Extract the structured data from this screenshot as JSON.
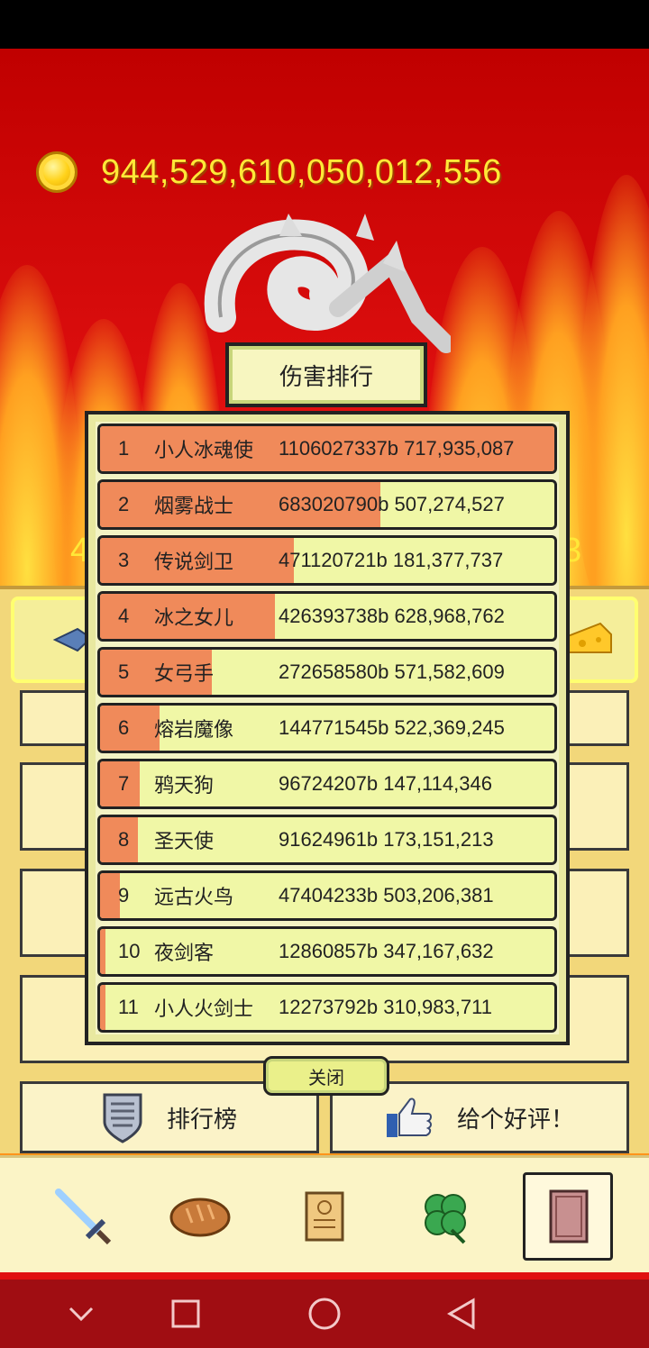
{
  "gold": {
    "amount": "944,529,610,050,012,556",
    "icon": "gold-coin-icon"
  },
  "colors": {
    "background_fire": "#e01010",
    "gold_text": "#ffe838",
    "rank_bar": "#f08a5a",
    "row_fill": "#f0f7a6"
  },
  "side_numbers": {
    "left": "4",
    "right": "3"
  },
  "ranking": {
    "title": "伤害排行",
    "rows": [
      {
        "rank": "1",
        "name": "小人冰魂使",
        "value": "1106027337b 717,935,087",
        "bar": 1.0
      },
      {
        "rank": "2",
        "name": "烟雾战士",
        "value": "683020790b 507,274,527",
        "bar": 0.617
      },
      {
        "rank": "3",
        "name": "传说剑卫",
        "value": "471120721b 181,377,737",
        "bar": 0.426
      },
      {
        "rank": "4",
        "name": "冰之女儿",
        "value": "426393738b 628,968,762",
        "bar": 0.385
      },
      {
        "rank": "5",
        "name": "女弓手",
        "value": "272658580b 571,582,609",
        "bar": 0.246
      },
      {
        "rank": "6",
        "name": "熔岩魔像",
        "value": "144771545b 522,369,245",
        "bar": 0.131
      },
      {
        "rank": "7",
        "name": "鸦天狗",
        "value": "96724207b 147,114,346",
        "bar": 0.087
      },
      {
        "rank": "8",
        "name": "圣天使",
        "value": "91624961b 173,151,213",
        "bar": 0.083
      },
      {
        "rank": "9",
        "name": "远古火鸟",
        "value": "47404233b 503,206,381",
        "bar": 0.043
      },
      {
        "rank": "10",
        "name": "夜剑客",
        "value": "12860857b 347,167,632",
        "bar": 0.012
      },
      {
        "rank": "11",
        "name": "小人火剑士",
        "value": "12273792b 310,983,711",
        "bar": 0.011
      }
    ],
    "close_label": "关闭"
  },
  "bottom_buttons": {
    "leaderboard": {
      "label": "排行榜",
      "icon": "shield-icon"
    },
    "review": {
      "label": "给个好评！",
      "icon": "thumbs-up-icon"
    }
  },
  "tabs": [
    {
      "name": "sword",
      "icon": "sword-icon"
    },
    {
      "name": "bread",
      "icon": "bread-icon"
    },
    {
      "name": "scroll",
      "icon": "scroll-icon"
    },
    {
      "name": "clover",
      "icon": "clover-icon"
    },
    {
      "name": "book",
      "icon": "book-icon",
      "active": true
    }
  ],
  "nav": [
    "chevron-down-icon",
    "square-icon",
    "circle-icon",
    "triangle-back-icon"
  ]
}
